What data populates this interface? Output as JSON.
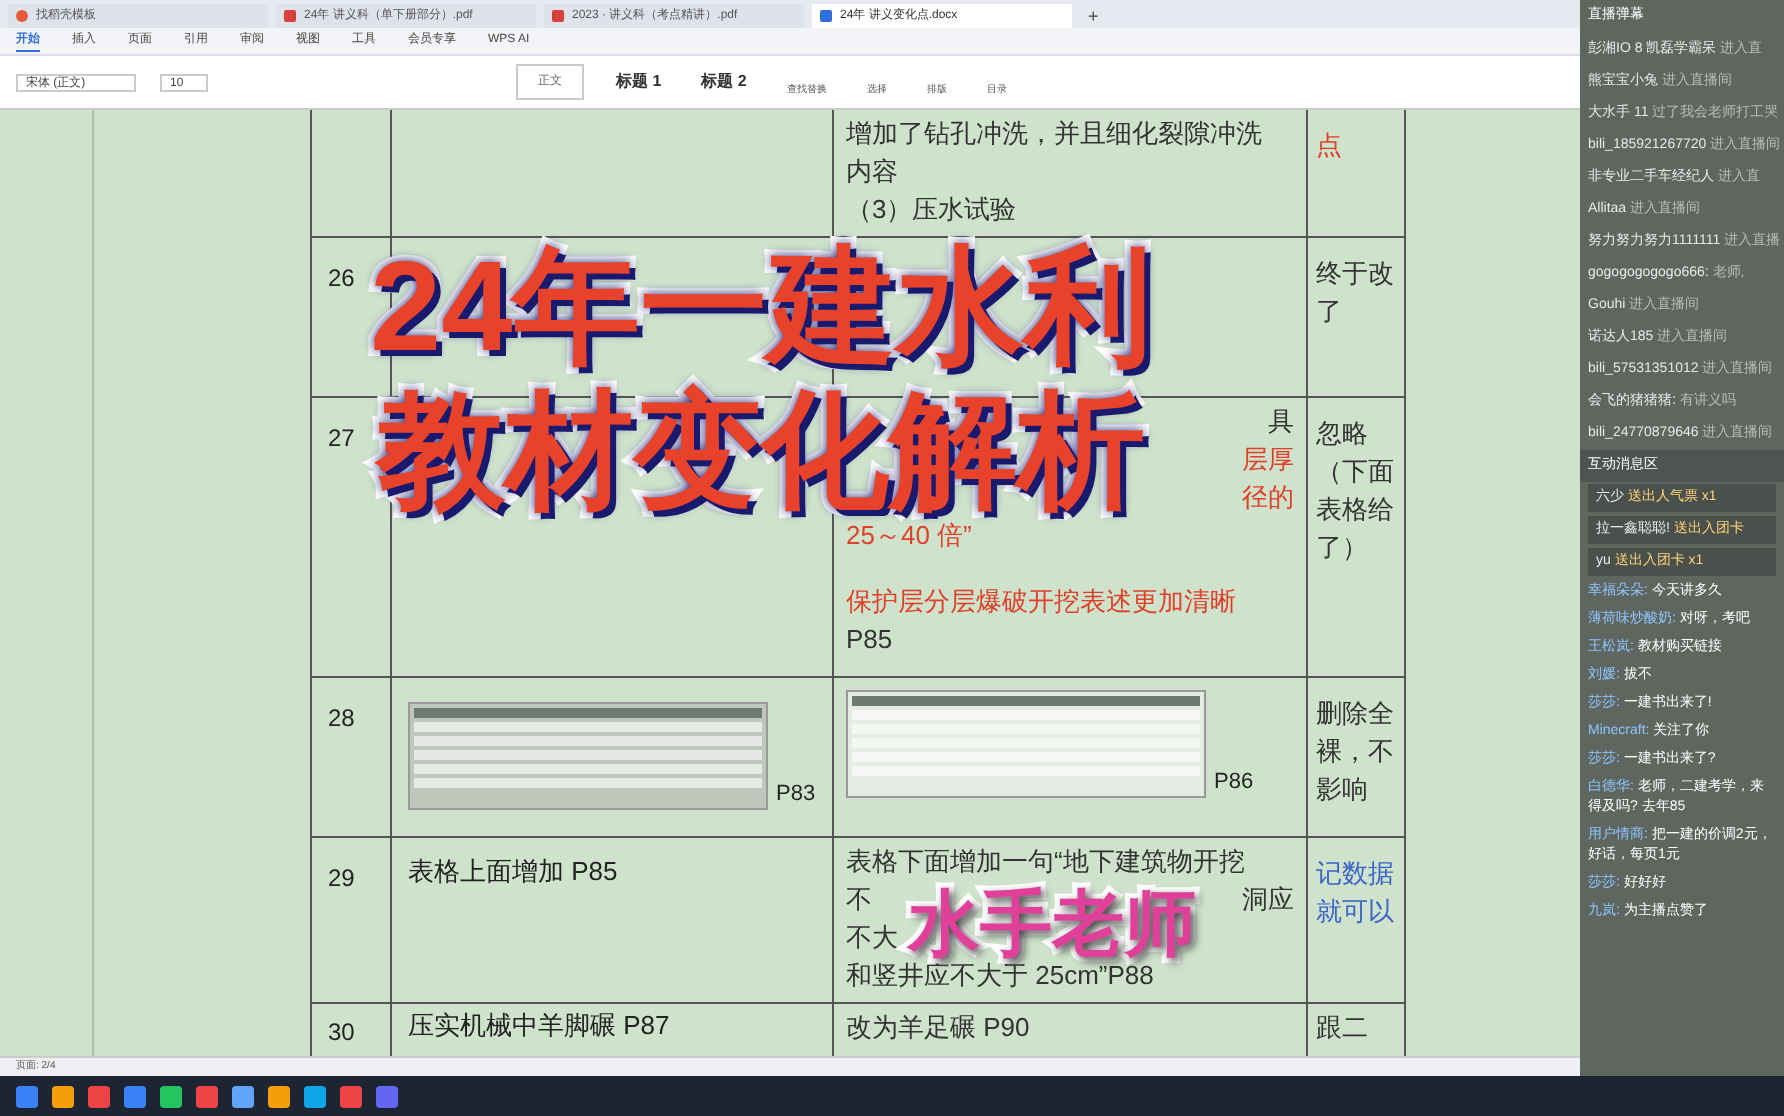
{
  "doc_tabs": [
    {
      "label": "找稻壳模板",
      "kind": "home",
      "selected": false
    },
    {
      "label": "24年 讲义科（单下册部分）.pdf",
      "kind": "pdf",
      "selected": false
    },
    {
      "label": "2023 · 讲义科（考点精讲）.pdf",
      "kind": "pdf",
      "selected": false
    },
    {
      "label": "24年 讲义变化点.docx",
      "kind": "doc",
      "selected": true
    }
  ],
  "new_tab": "+",
  "menu": [
    {
      "label": "开始",
      "selected": true
    },
    {
      "label": "插入",
      "selected": false
    },
    {
      "label": "页面",
      "selected": false
    },
    {
      "label": "引用",
      "selected": false
    },
    {
      "label": "审阅",
      "selected": false
    },
    {
      "label": "视图",
      "selected": false
    },
    {
      "label": "工具",
      "selected": false
    },
    {
      "label": "会员专享",
      "selected": false
    },
    {
      "label": "WPS AI",
      "selected": false
    }
  ],
  "ribbon": {
    "font": "宋体 (正文)",
    "size": "10",
    "styles": [
      "正文",
      "标题 1",
      "标题 2"
    ],
    "tools": [
      "查找替换",
      "选择",
      "排版",
      "目录"
    ]
  },
  "table": {
    "rows": [
      {
        "number": "",
        "old": "",
        "new": [
          {
            "parts": [
              "增加了钻孔冲洗，并且细化裂隙冲洗"
            ],
            "kind": "plain"
          },
          {
            "parts": [
              "内容"
            ],
            "kind": "plain"
          },
          {
            "parts": [
              "（3）压水试验"
            ],
            "kind": "plain"
          }
        ],
        "note": {
          "text": "点",
          "kind": "red"
        }
      },
      {
        "number": "26",
        "old": "",
        "new": [],
        "note": {
          "text": "终于改了",
          "kind": "plain"
        }
      },
      {
        "number": "27",
        "old": "",
        "new": [
          {
            "parts": [
              "具"
            ],
            "kind": "plain_right"
          },
          {
            "parts": [
              "层厚"
            ],
            "kind": "red_right"
          },
          {
            "parts": [
              "径的"
            ],
            "kind": "red_right"
          },
          {
            "parts": [
              "25～40 倍”"
            ],
            "kind": "red"
          },
          {
            "parts": [
              "保护层分层爆破开挖表述更加清晰"
            ],
            "kind": "red_gap"
          },
          {
            "parts": [
              "P85"
            ],
            "kind": "plain"
          }
        ],
        "note": {
          "text": "忽略（下面表格给了）",
          "kind": "plain"
        }
      },
      {
        "number": "28",
        "old": "",
        "old_image": "P83",
        "new": [],
        "new_image": "P86",
        "note": {
          "text": "删除全裸，不影响",
          "kind": "plain"
        }
      },
      {
        "number": "29",
        "old": "表格上面增加 P85",
        "new": [
          {
            "parts": [
              "表格下面增加一句“地下建筑物开挖"
            ],
            "kind": "plain"
          },
          {
            "parts": [
              "不",
              "洞应"
            ],
            "kind": "plain"
          },
          {
            "parts": [
              "不大"
            ],
            "kind": "plain"
          },
          {
            "parts": [
              "和竖井应不大于 25cm”P88"
            ],
            "kind": "plain"
          }
        ],
        "note": {
          "text": "记数据就可以",
          "kind": "blue"
        }
      },
      {
        "number": "30",
        "old": "压实机械中羊脚碾 P87",
        "new": [
          {
            "parts": [
              "改为羊足碾 P90"
            ],
            "kind": "plain"
          }
        ],
        "note": {
          "text": "跟二",
          "kind": "plain"
        }
      }
    ]
  },
  "overlay": {
    "title_lines": [
      "24年一建水利",
      "教材变化解析"
    ],
    "author": "水手老师"
  },
  "status_bar": {
    "page": "页面: 2/4"
  },
  "chat": {
    "header": "直播弹幕",
    "enter_messages": [
      {
        "user": "彭湘IO 8 凯磊学霸呆",
        "text": "进入直"
      },
      {
        "user": "熊宝宝小兔",
        "text": "进入直播间"
      },
      {
        "user": "大水手 11",
        "text": "过了我会老师打工哭"
      },
      {
        "user": "bili_185921267720",
        "text": "进入直播间"
      },
      {
        "user": "非专业二手车经纪人",
        "text": "进入直"
      },
      {
        "user": "Allitaa",
        "text": "进入直播间"
      },
      {
        "user": "努力努力努力1111111",
        "text": "进入直播"
      },
      {
        "user": "gogogogogogo666:",
        "text": "老师,"
      },
      {
        "user": "Gouhi",
        "text": "进入直播间"
      },
      {
        "user": "诺达人185",
        "text": "进入直播间"
      },
      {
        "user": "bili_57531351012",
        "text": "进入直播间"
      },
      {
        "user": "会飞的猪猪猪:",
        "text": "有讲义吗"
      },
      {
        "user": "bili_24770879646",
        "text": "进入直播间"
      }
    ],
    "section": "互动消息区",
    "gifts": [
      {
        "user": "六少",
        "text": "送出人气票 x1"
      },
      {
        "user": "拉一鑫聪聪!",
        "text": "送出入团卡"
      },
      {
        "user": "yu",
        "text": "送出入团卡 x1"
      }
    ],
    "comments": [
      {
        "user": "幸福朵朵:",
        "text": "今天讲多久"
      },
      {
        "user": "薄荷味炒酸奶:",
        "text": "对呀，考吧"
      },
      {
        "user": "王松岚:",
        "text": "教材购买链接"
      },
      {
        "user": "刘媛:",
        "text": "拔不"
      },
      {
        "user": "莎莎:",
        "text": "一建书出来了!"
      },
      {
        "user": "Minecraft:",
        "text": "关注了你"
      },
      {
        "user": "莎莎:",
        "text": "一建书出来了?"
      },
      {
        "user": "白德华:",
        "text": "老师，二建考学，来得及吗? 去年85"
      },
      {
        "user": "用户情商:",
        "text": "把一建的价调2元，好话，每页1元"
      },
      {
        "user": "莎莎:",
        "text": "好好好"
      },
      {
        "user": "九岚:",
        "text": "为主播点赞了"
      }
    ]
  }
}
